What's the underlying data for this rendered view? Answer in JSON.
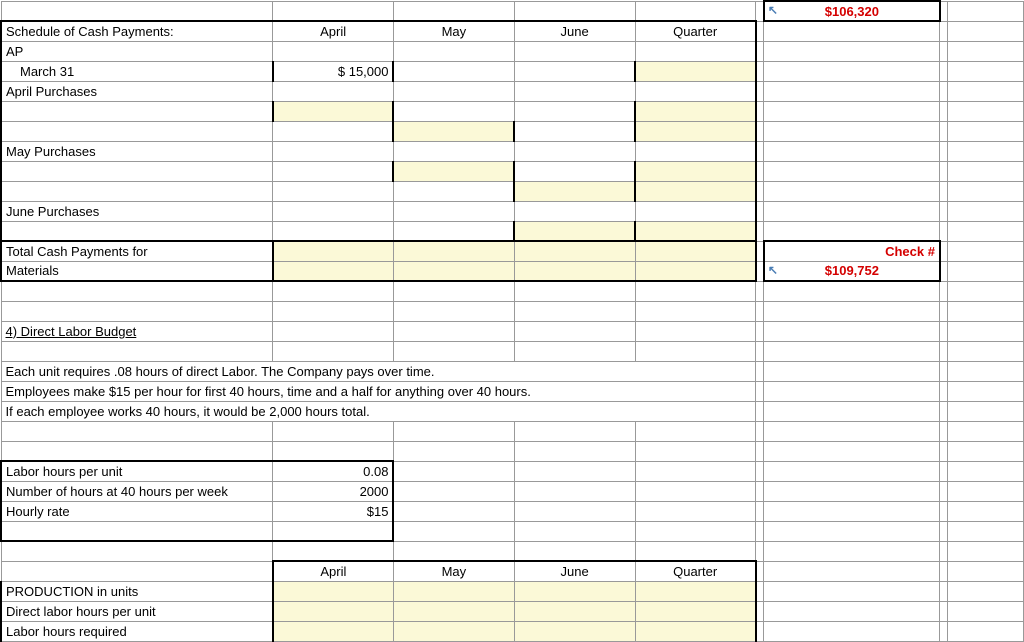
{
  "topCheck": "$106,320",
  "schedule": {
    "title": "Schedule of Cash Payments:",
    "cols": [
      "April",
      "May",
      "June",
      "Quarter"
    ],
    "rows": {
      "ap": "AP",
      "march31": "March 31",
      "march31_val": "$       15,000",
      "aprilPurchases": "April Purchases",
      "mayPurchases": "May Purchases",
      "junePurchases": "June Purchases",
      "totals_l1": "Total Cash Payments for",
      "totals_l2": "Materials"
    }
  },
  "checkLabel": "Check #",
  "checkValue": "$109,752",
  "section4": {
    "heading": "4)  Direct Labor Budget",
    "line1": "Each unit requires .08 hours of direct Labor.  The Company pays over time.",
    "line2": "Employees make $15 per hour for first 40 hours, time and a half for anything over 40 hours.",
    "line3": "If each employee works 40 hours, it would be 2,000 hours total.",
    "labor_per_unit_label": "Labor hours per unit",
    "labor_per_unit_val": "0.08",
    "hours40_label": "Number of hours at 40 hours per week",
    "hours40_val": "2000",
    "hourly_label": "Hourly rate",
    "hourly_val": "$15"
  },
  "prod": {
    "cols": [
      "April",
      "May",
      "June",
      "Quarter"
    ],
    "row1": "PRODUCTION in units",
    "row2": "Direct labor hours per unit",
    "row3": "Labor hours required"
  }
}
